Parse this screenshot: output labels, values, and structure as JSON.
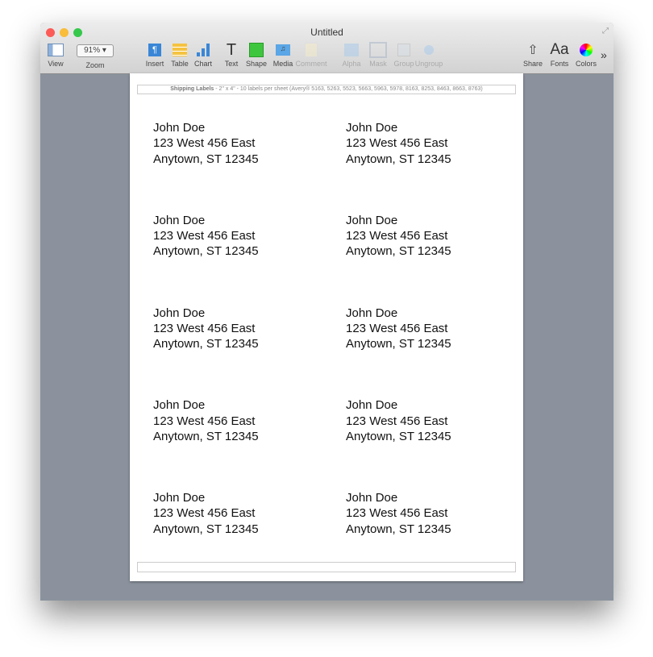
{
  "window": {
    "title": "Untitled"
  },
  "toolbar": {
    "view": "View",
    "zoom_label": "Zoom",
    "zoom_value": "91%",
    "tools": [
      {
        "label": "Insert",
        "icon": "insert-icon",
        "enabled": true
      },
      {
        "label": "Table",
        "icon": "table-icon",
        "enabled": true
      },
      {
        "label": "Chart",
        "icon": "chart-icon",
        "enabled": true
      },
      {
        "label": "Text",
        "icon": "text-icon",
        "enabled": true
      },
      {
        "label": "Shape",
        "icon": "shape-icon",
        "enabled": true
      },
      {
        "label": "Media",
        "icon": "media-icon",
        "enabled": true
      },
      {
        "label": "Comment",
        "icon": "comment-icon",
        "enabled": false
      },
      {
        "label": "Alpha",
        "icon": "alpha-icon",
        "enabled": false
      },
      {
        "label": "Mask",
        "icon": "mask-icon",
        "enabled": false
      },
      {
        "label": "Group",
        "icon": "group-icon",
        "enabled": false
      },
      {
        "label": "Ungroup",
        "icon": "ungroup-icon",
        "enabled": false
      }
    ],
    "share": "Share",
    "fonts": "Fonts",
    "fonts_glyph": "Aa",
    "colors": "Colors",
    "more": "»"
  },
  "page": {
    "header_bold": "Shipping Labels",
    "header_rest": " - 2\" x 4\" - 10 labels per sheet (Avery® 5163, 5263, 5523, 5663, 5963, 5978, 8163, 8253, 8463, 8663, 8763)",
    "labels": [
      {
        "name": "John Doe",
        "street": "123 West 456 East",
        "city": "Anytown, ST 12345"
      },
      {
        "name": "John Doe",
        "street": "123 West 456 East",
        "city": "Anytown, ST 12345"
      },
      {
        "name": "John Doe",
        "street": "123 West 456 East",
        "city": "Anytown, ST 12345"
      },
      {
        "name": "John Doe",
        "street": "123 West 456 East",
        "city": "Anytown, ST 12345"
      },
      {
        "name": "John Doe",
        "street": "123 West 456 East",
        "city": "Anytown, ST 12345"
      },
      {
        "name": "John Doe",
        "street": "123 West 456 East",
        "city": "Anytown, ST 12345"
      },
      {
        "name": "John Doe",
        "street": "123 West 456 East",
        "city": "Anytown, ST 12345"
      },
      {
        "name": "John Doe",
        "street": "123 West 456 East",
        "city": "Anytown, ST 12345"
      },
      {
        "name": "John Doe",
        "street": "123 West 456 East",
        "city": "Anytown, ST 12345"
      },
      {
        "name": "John Doe",
        "street": "123 West 456 East",
        "city": "Anytown, ST 12345"
      }
    ]
  },
  "colors": {
    "close": "#fc5b57",
    "minimize": "#f9bd3a",
    "zoom": "#35c84b",
    "canvas": "#8b929e"
  }
}
